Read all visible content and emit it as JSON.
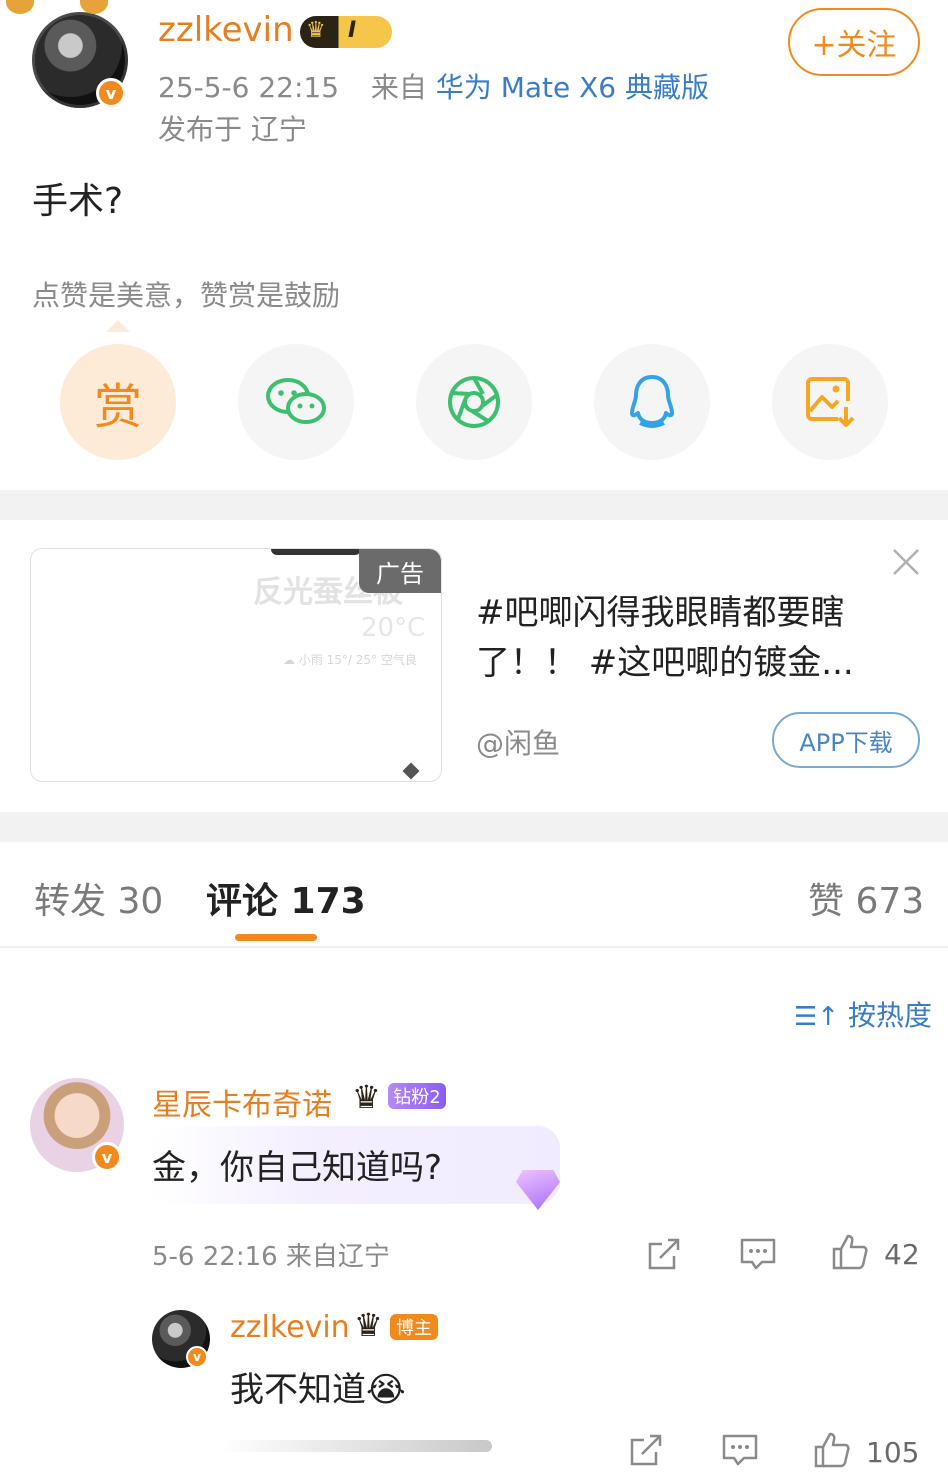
{
  "post": {
    "author": "zzlkevin",
    "member_level": "I",
    "time": "25-5-6 22:15",
    "source_prefix": "来自",
    "device": "华为 Mate X6 典藏版",
    "location": "发布于 辽宁",
    "follow_label": "+关注",
    "content": "手术?"
  },
  "reward": {
    "tip": "点赞是美意，赞赏是鼓励",
    "reward_label": "赏",
    "share_icons": [
      "wechat-icon",
      "moments-icon",
      "qq-icon",
      "save-image-icon"
    ]
  },
  "ad": {
    "tag": "广告",
    "image_text_1": "反光蚕丝被",
    "image_text_2": "20°C",
    "image_text_3": "☁ 小雨 15°/ 25° 空气良",
    "title": "#吧唧闪得我眼睛都要瞎了！！ #这吧唧的镀金...",
    "source": "@闲鱼",
    "download_label": "APP下载",
    "close_icon": "close-icon"
  },
  "tabs": {
    "repost": "转发 30",
    "comments": "评论 173",
    "likes": "赞 673"
  },
  "sort_label": "按热度",
  "comments": [
    {
      "name": "星辰卡布奇诺",
      "badge": "钻粉2",
      "text": "金，你自己知道吗?",
      "meta": "5-6 22:16 来自辽宁",
      "likes": "42"
    }
  ],
  "reply": {
    "name": "zzlkevin",
    "badge": "博主",
    "text": "我不知道😭",
    "likes": "105"
  },
  "colors": {
    "accent": "#f08a1c",
    "link": "#3a7cc8",
    "wechat": "#3cbf6e",
    "qq": "#33a3e6",
    "save": "#f5a623"
  }
}
